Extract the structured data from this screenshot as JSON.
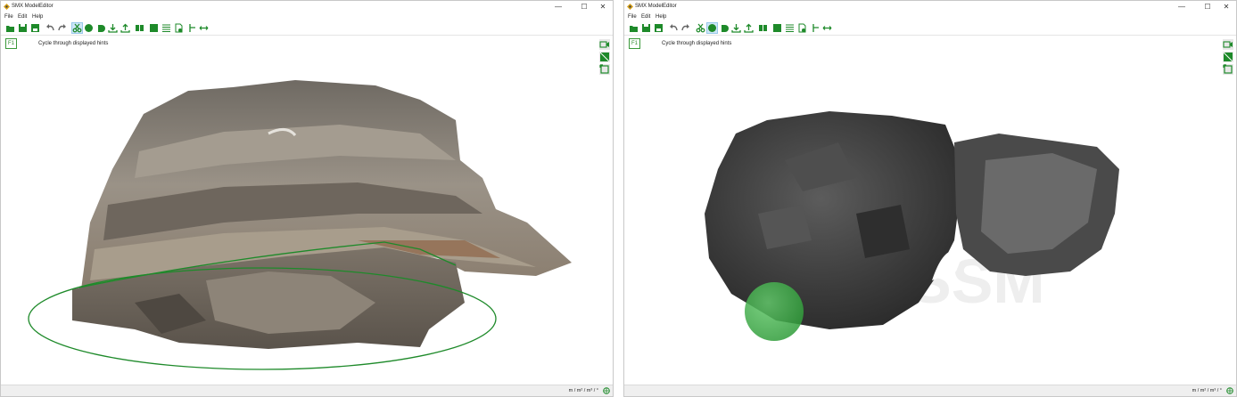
{
  "left": {
    "title": "SMX ModelEditor",
    "menu": [
      "File",
      "Edit",
      "Help"
    ],
    "window_controls": {
      "minimize": "—",
      "maximize": "☐",
      "close": "✕"
    },
    "hint_key": "F1",
    "hint_text": "Cycle through displayed hints",
    "units": "m / m² / m³ / °"
  },
  "right": {
    "title": "SMX ModelEditor",
    "menu": [
      "File",
      "Edit",
      "Help"
    ],
    "window_controls": {
      "minimize": "—",
      "maximize": "☐",
      "close": "✕"
    },
    "hint_key": "F1",
    "hint_text": "Cycle through displayed hints",
    "units": "m / m² / m³ / °"
  },
  "toolbar_icons": [
    "open-folder-icon",
    "save-icon",
    "save-as-icon",
    "undo-icon",
    "redo-icon",
    "cut-icon",
    "sphere-select-icon",
    "contour-icon",
    "import-icon",
    "export-icon",
    "split-view-icon",
    "fill-square-icon",
    "list-icon",
    "measure-doc-icon",
    "axis-icon",
    "distance-icon"
  ],
  "left_active_tool": "cut-icon",
  "right_active_tool": "sphere-select-icon",
  "colors": {
    "accent_green": "#1e8a2a",
    "selection_green": "#3cb043"
  },
  "watermark": "SSM"
}
